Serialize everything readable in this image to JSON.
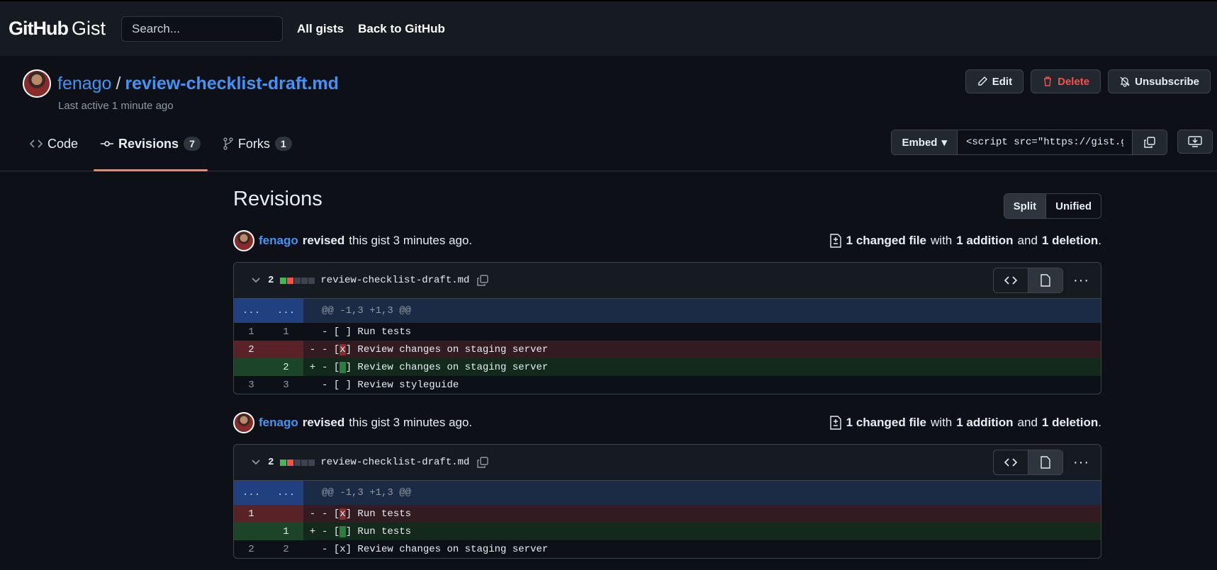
{
  "header": {
    "logo_primary": "GitHub",
    "logo_secondary": "Gist",
    "search_placeholder": "Search...",
    "nav": [
      "All gists",
      "Back to GitHub"
    ]
  },
  "gist": {
    "owner": "fenago",
    "separator": "/",
    "filename": "review-checklist-draft.md",
    "last_active": "Last active 1 minute ago",
    "actions": {
      "edit": "Edit",
      "delete": "Delete",
      "unsubscribe": "Unsubscribe"
    },
    "tabs": [
      {
        "label": "Code",
        "count": ""
      },
      {
        "label": "Revisions",
        "count": "7"
      },
      {
        "label": "Forks",
        "count": "1"
      }
    ],
    "embed": {
      "label": "Embed",
      "value": "<script src=\"https://gist.github.com/"
    }
  },
  "revisions": {
    "title": "Revisions",
    "view_toggle": {
      "split": "Split",
      "unified": "Unified"
    },
    "items": [
      {
        "author": "fenago",
        "verb": "revised",
        "text": "this gist 3 minutes ago.",
        "summary": {
          "changed": "1 changed file",
          "with": "with",
          "additions": "1 addition",
          "and": "and",
          "deletions": "1 deletion",
          "end": "."
        },
        "file": {
          "changes": "2",
          "name": "review-checklist-draft.md",
          "hunk": "@@ -1,3 +1,3 @@",
          "lines": [
            {
              "type": "ctx",
              "old": "1",
              "new": "1",
              "sign": "",
              "pre": "- [",
              "mark": " ",
              "post": "] Run tests"
            },
            {
              "type": "del",
              "old": "2",
              "new": "",
              "sign": "-",
              "pre": "- [",
              "mark": "x",
              "post": "] Review changes on staging server"
            },
            {
              "type": "add",
              "old": "",
              "new": "2",
              "sign": "+",
              "pre": "- [",
              "mark": " ",
              "post": "] Review changes on staging server"
            },
            {
              "type": "ctx",
              "old": "3",
              "new": "3",
              "sign": "",
              "pre": "- [",
              "mark": " ",
              "post": "] Review styleguide"
            }
          ]
        }
      },
      {
        "author": "fenago",
        "verb": "revised",
        "text": "this gist 3 minutes ago.",
        "summary": {
          "changed": "1 changed file",
          "with": "with",
          "additions": "1 addition",
          "and": "and",
          "deletions": "1 deletion",
          "end": "."
        },
        "file": {
          "changes": "2",
          "name": "review-checklist-draft.md",
          "hunk": "@@ -1,3 +1,3 @@",
          "lines": [
            {
              "type": "del",
              "old": "1",
              "new": "",
              "sign": "-",
              "pre": "- [",
              "mark": "x",
              "post": "] Run tests"
            },
            {
              "type": "add",
              "old": "",
              "new": "1",
              "sign": "+",
              "pre": "- [",
              "mark": " ",
              "post": "] Run tests"
            },
            {
              "type": "ctx",
              "old": "2",
              "new": "2",
              "sign": "",
              "pre": "- [",
              "mark": "x",
              "post": "] Review changes on staging server"
            }
          ]
        }
      }
    ]
  },
  "colors": {
    "accent": "#4493f8",
    "danger": "#f85149",
    "tab_underline": "#f78166"
  }
}
